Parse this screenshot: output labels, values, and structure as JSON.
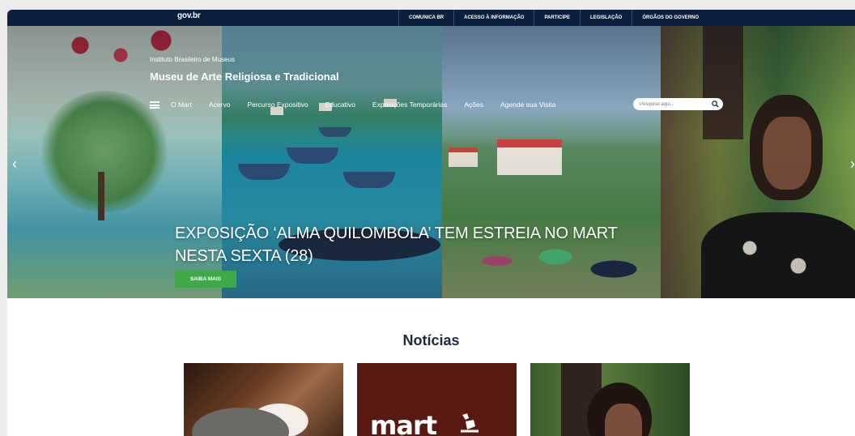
{
  "gov_bar": {
    "logo": "gov.br",
    "links": [
      "COMUNICA BR",
      "ACESSO À INFORMAÇÃO",
      "PARTICIPE",
      "LEGISLAÇÃO",
      "ÓRGÃOS DO GOVERNO"
    ]
  },
  "header": {
    "institution": "Instituto Brasileiro de Museus",
    "museum": "Museu de Arte Religiosa e Tradicional",
    "menu": [
      "O Mart",
      "Acervo",
      "Percurso Expositivo",
      "Educativo",
      "Exposições Temporárias",
      "Ações",
      "Agende sua Visita"
    ],
    "search_placeholder": "Pesquise aqui..."
  },
  "hero": {
    "headline": "EXPOSIÇÃO ‘ALMA QUILOMBOLA’ TEM ESTREIA NO MART NESTA SEXTA (28)",
    "cta_label": "SAIBA MAIS",
    "prev_arrow": "‹",
    "next_arrow": "›"
  },
  "news": {
    "title": "Notícias",
    "card2_logo_text": "mart"
  },
  "colors": {
    "gov_bar": "#0c1f3e",
    "cta_green": "#3fa949",
    "news_title": "#1c2a3c"
  }
}
